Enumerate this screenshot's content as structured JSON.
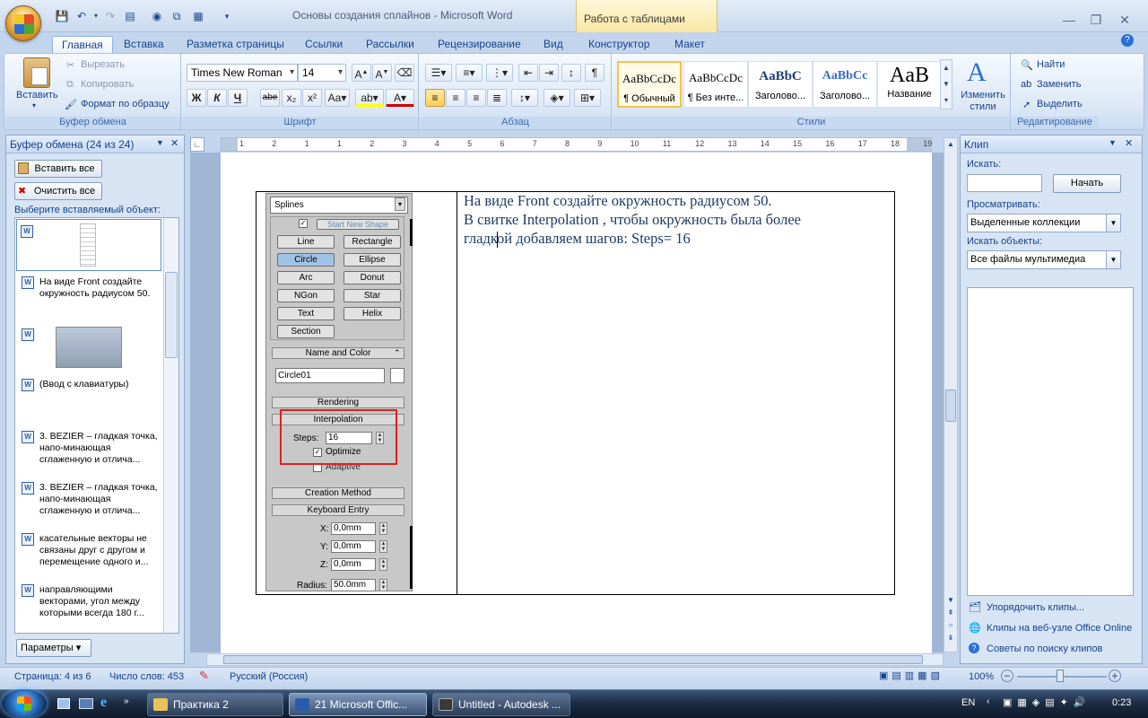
{
  "window": {
    "title": "Основы создания сплайнов - Microsoft Word",
    "context_tab_group": "Работа с таблицами"
  },
  "tabs": [
    "Главная",
    "Вставка",
    "Разметка страницы",
    "Ссылки",
    "Рассылки",
    "Рецензирование",
    "Вид",
    "Конструктор",
    "Макет"
  ],
  "ribbon": {
    "clipboard": {
      "paste": "Вставить",
      "cut": "Вырезать",
      "copy": "Копировать",
      "format_painter": "Формат по образцу",
      "label": "Буфер обмена"
    },
    "font": {
      "name": "Times New Roman",
      "size": "14",
      "label": "Шрифт"
    },
    "paragraph": {
      "label": "Абзац"
    },
    "styles": {
      "tiles": [
        {
          "preview": "AaBbCcDc",
          "name": "¶ Обычный"
        },
        {
          "preview": "AaBbCcDc",
          "name": "¶ Без инте..."
        },
        {
          "preview": "AaBbC",
          "name": "Заголово..."
        },
        {
          "preview": "AaBbCc",
          "name": "Заголово..."
        },
        {
          "preview": "AaB",
          "name": "Название"
        }
      ],
      "change_styles": "Изменить стили",
      "label": "Стили"
    },
    "editing": {
      "find": "Найти",
      "replace": "Заменить",
      "select": "Выделить",
      "label": "Редактирование"
    }
  },
  "clipboard_pane": {
    "title": "Буфер обмена (24 из 24)",
    "paste_all": "Вставить все",
    "clear_all": "Очистить все",
    "choose_label": "Выберите вставляемый объект:",
    "items": [
      {
        "text": ""
      },
      {
        "text": "На виде Front создайте окружность радиусом 50."
      },
      {
        "text": ""
      },
      {
        "text": "(Ввод с клавиатуры)"
      },
      {
        "text": "3. BEZIER – гладкая точка, напо-минающая сглаженную и отлича..."
      },
      {
        "text": "3. BEZIER – гладкая точка, напо-минающая сглаженную и отлича..."
      },
      {
        "text": "касательные векторы не связаны друг с другом и перемещение одного и..."
      },
      {
        "text": "направляющими векторами, угол между которыми всегда 180 г..."
      }
    ],
    "options": "Параметры"
  },
  "document": {
    "lines": [
      "На виде Front создайте окружность радиусом 50.",
      "В свитке Interpolation , чтобы окружность была более",
      "гладкой добавляем шагов: Steps= 16"
    ],
    "max_panel": {
      "dropdown": "Splines",
      "start_new_shape": "Start New Shape",
      "buttons": [
        "Line",
        "Rectangle",
        "Circle",
        "Ellipse",
        "Arc",
        "Donut",
        "NGon",
        "Star",
        "Text",
        "Helix",
        "Section"
      ],
      "name_and_color": "Name and Color",
      "object_name": "Circle01",
      "rendering": "Rendering",
      "interpolation": "Interpolation",
      "steps_label": "Steps:",
      "steps_value": "16",
      "optimize": "Optimize",
      "adaptive": "Adaptive",
      "creation_method": "Creation Method",
      "keyboard_entry": "Keyboard Entry",
      "x_label": "X:",
      "x_value": "0,0mm",
      "y_label": "Y:",
      "y_value": "0,0mm",
      "z_label": "Z:",
      "z_value": "0,0mm",
      "radius_label": "Radius:",
      "radius_value": "50.0mm"
    },
    "ruler_numbers": [
      "1",
      "2",
      "1",
      "1",
      "2",
      "3",
      "4",
      "5",
      "6",
      "7",
      "8",
      "9",
      "10",
      "11",
      "12",
      "13",
      "14",
      "15",
      "16",
      "17",
      "18",
      "19"
    ]
  },
  "clip_pane": {
    "title": "Клип",
    "search_label": "Искать:",
    "search_value": "",
    "go_button": "Начать",
    "browse_label": "Просматривать:",
    "browse_value": "Выделенные коллекции",
    "types_label": "Искать объекты:",
    "types_value": "Все файлы мультимедиа",
    "links": [
      "Упорядочить клипы...",
      "Клипы на веб-узле Office Online",
      "Советы по поиску клипов"
    ]
  },
  "statusbar": {
    "page": "Страница: 4 из 6",
    "words": "Число слов: 453",
    "language": "Русский (Россия)",
    "zoom": "100%"
  },
  "taskbar": {
    "items": [
      {
        "label": "Практика 2"
      },
      {
        "label": "21 Microsoft Offic..."
      },
      {
        "label": "Untitled - Autodesk ..."
      }
    ],
    "lang": "EN",
    "time": "0:23"
  },
  "colors": {
    "accent": "#15428b",
    "highlight": "#ffcf55",
    "red_box": "#e02020",
    "taskbar": "#1c2d44"
  }
}
